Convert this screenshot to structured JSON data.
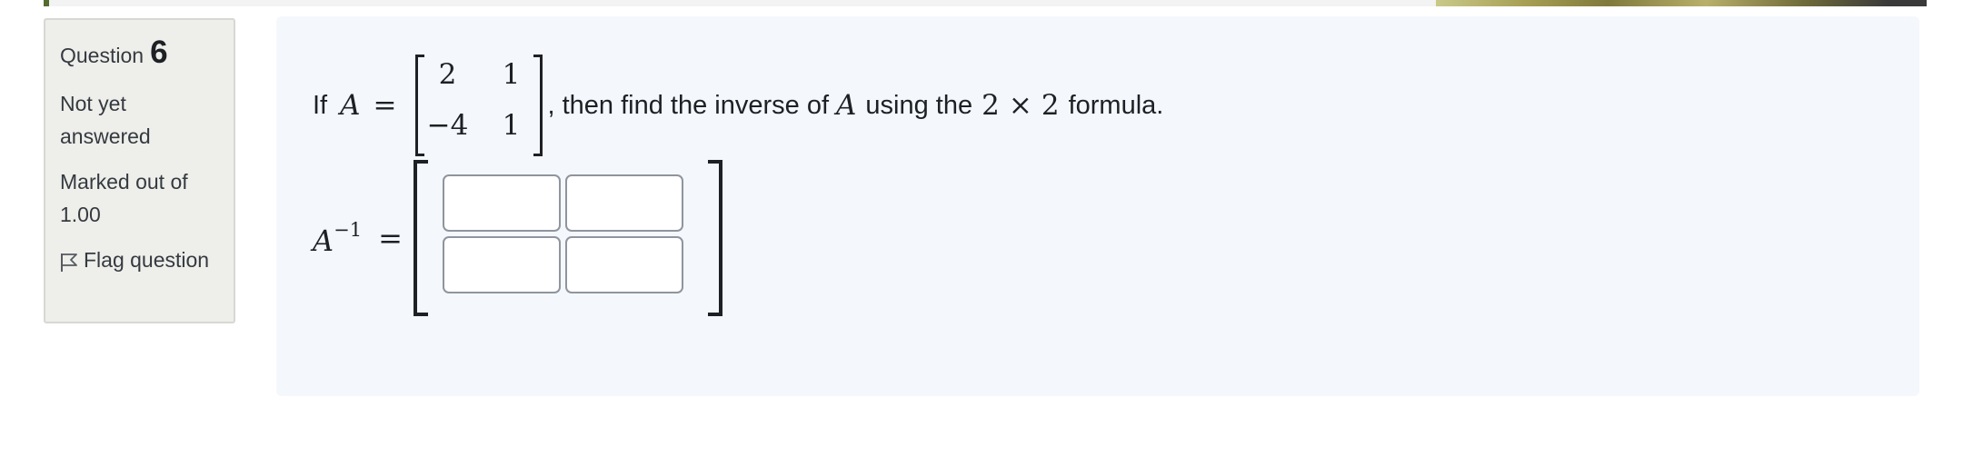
{
  "colors": {
    "info_bg": "#eeeeea",
    "content_bg": "#f4f7fc",
    "text": "#1d2125",
    "input_border": "#8f959e",
    "strip_accent": "#556b2f"
  },
  "info": {
    "question_label": "Question",
    "question_number": "6",
    "state": "Not yet answered",
    "grade": "Marked out of 1.00",
    "flag_label": "Flag question",
    "flag_icon": "flag-outline-icon"
  },
  "question": {
    "prefix": "If",
    "matrix_name": "A",
    "equals": "=",
    "matrix": [
      [
        "2",
        "1"
      ],
      [
        "−4",
        "1"
      ]
    ],
    "text_after_matrix": ", then find the inverse of",
    "text_A": "A",
    "text_using": "using the",
    "dim_a": "2",
    "times": "×",
    "dim_b": "2",
    "text_formula": "formula."
  },
  "answer": {
    "lhs_base": "A",
    "lhs_exponent": "−1",
    "equals": "=",
    "inputs": [
      {
        "value": "",
        "placeholder": ""
      },
      {
        "value": "",
        "placeholder": ""
      },
      {
        "value": "",
        "placeholder": ""
      },
      {
        "value": "",
        "placeholder": ""
      }
    ]
  }
}
